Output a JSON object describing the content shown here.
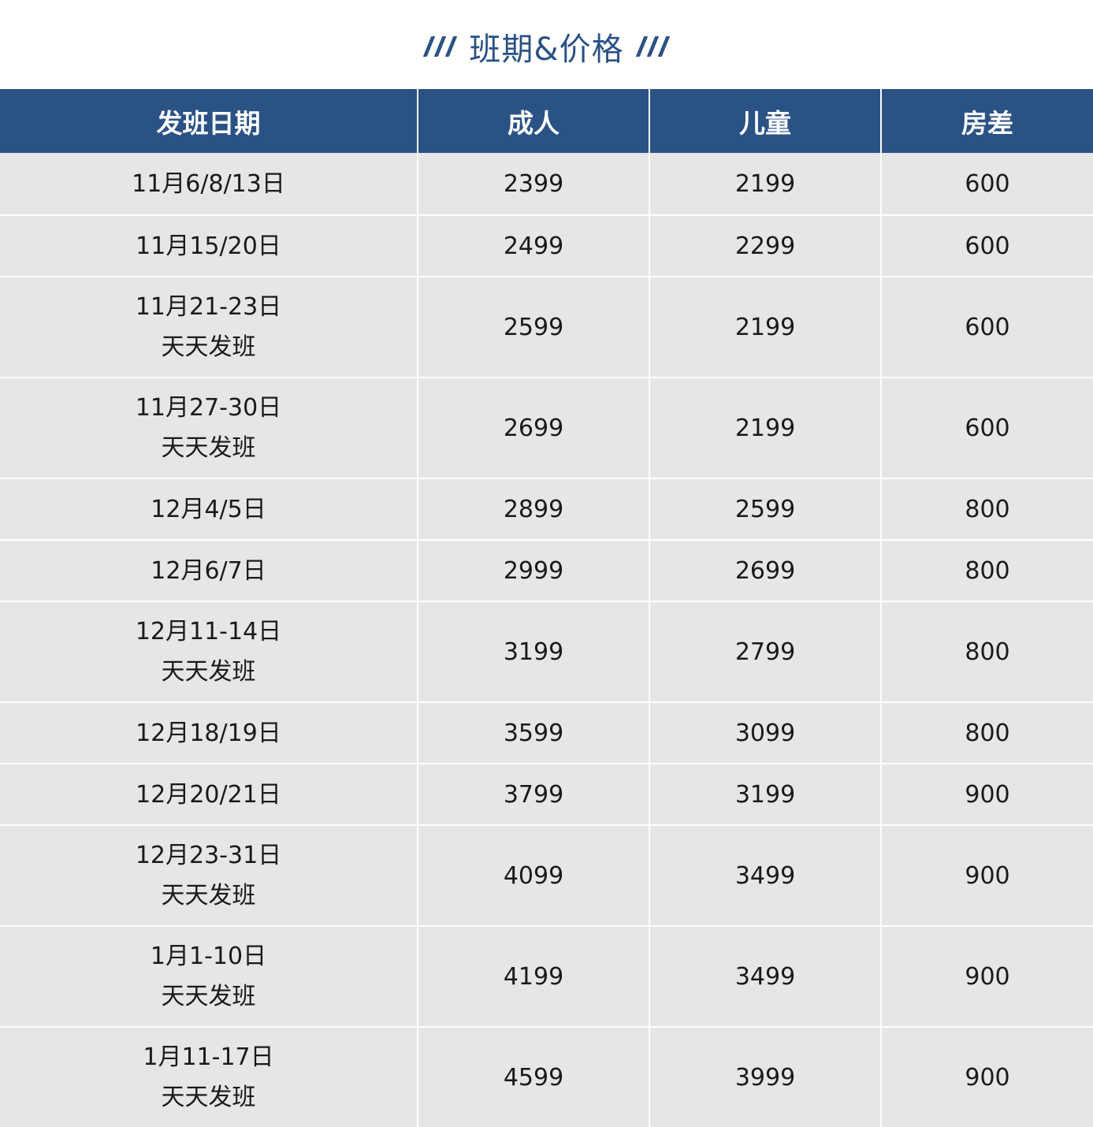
{
  "title": "班期&价格",
  "table": {
    "headers": [
      "发班日期",
      "成人",
      "儿童",
      "房差"
    ],
    "rows": [
      {
        "date": "11月6/8/13日",
        "note": "",
        "adult": "2399",
        "child": "2199",
        "room": "600"
      },
      {
        "date": "11月15/20日",
        "note": "",
        "adult": "2499",
        "child": "2299",
        "room": "600"
      },
      {
        "date": "11月21-23日",
        "note": "天天发班",
        "adult": "2599",
        "child": "2199",
        "room": "600"
      },
      {
        "date": "11月27-30日",
        "note": "天天发班",
        "adult": "2699",
        "child": "2199",
        "room": "600"
      },
      {
        "date": "12月4/5日",
        "note": "",
        "adult": "2899",
        "child": "2599",
        "room": "800"
      },
      {
        "date": "12月6/7日",
        "note": "",
        "adult": "2999",
        "child": "2699",
        "room": "800"
      },
      {
        "date": "12月11-14日",
        "note": "天天发班",
        "adult": "3199",
        "child": "2799",
        "room": "800"
      },
      {
        "date": "12月18/19日",
        "note": "",
        "adult": "3599",
        "child": "3099",
        "room": "800"
      },
      {
        "date": "12月20/21日",
        "note": "",
        "adult": "3799",
        "child": "3199",
        "room": "900"
      },
      {
        "date": "12月23-31日",
        "note": "天天发班",
        "adult": "4099",
        "child": "3499",
        "room": "900"
      },
      {
        "date": "1月1-10日",
        "note": "天天发班",
        "adult": "4199",
        "child": "3499",
        "room": "900"
      },
      {
        "date": "1月11-17日",
        "note": "天天发班",
        "adult": "4599",
        "child": "3999",
        "room": "900"
      }
    ]
  },
  "colors": {
    "accent": "#2b5285",
    "row_bg": "#e6e6e6",
    "divider": "#ffffff"
  }
}
